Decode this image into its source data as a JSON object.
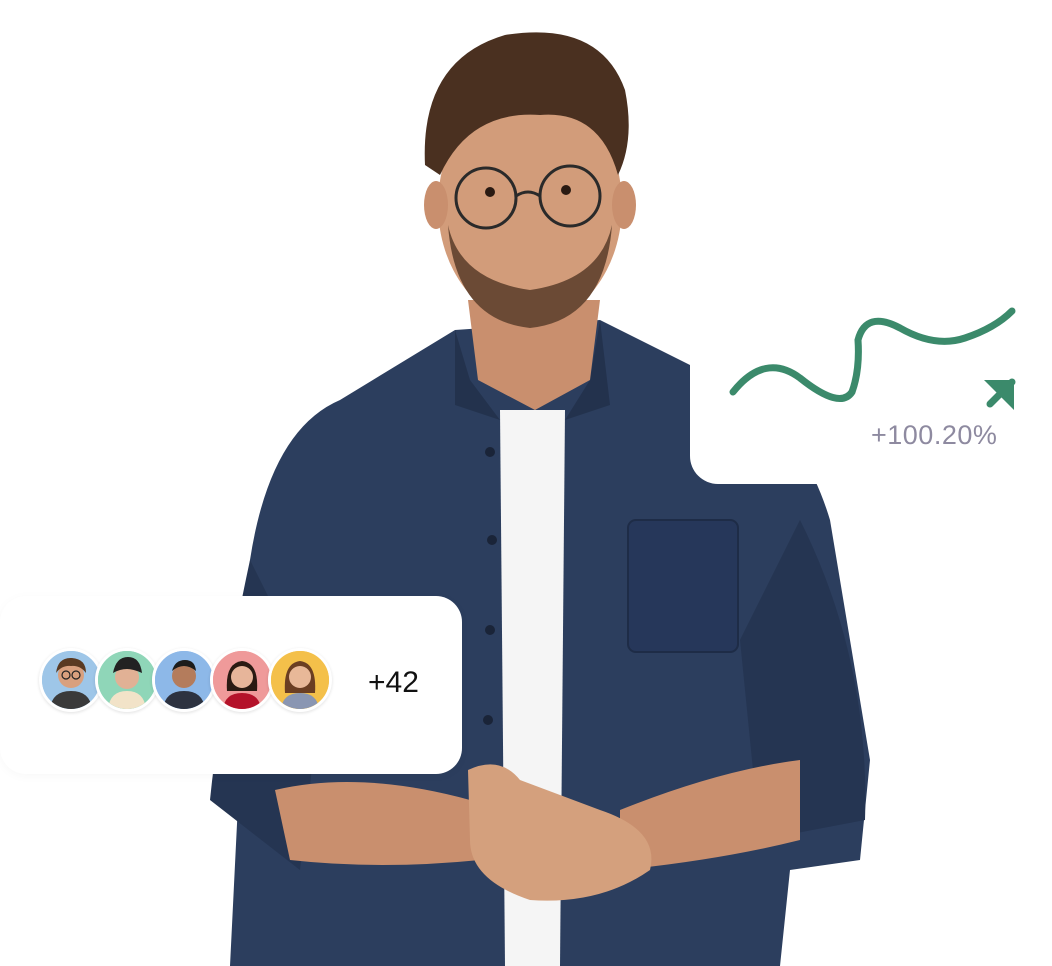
{
  "growth": {
    "value_label": "+100.20%",
    "line_color": "#3b8a6b",
    "label_color": "#8e8aa0"
  },
  "people": {
    "count_label": "+42",
    "avatars": [
      {
        "name": "avatar-1",
        "bg": "#9ec6e8",
        "shirt": "#3a3a3a",
        "hair": "#5a3a22"
      },
      {
        "name": "avatar-2",
        "bg": "#8fd6b8",
        "shirt": "#f2e3c8",
        "hair": "#222222"
      },
      {
        "name": "avatar-3",
        "bg": "#8db8e8",
        "shirt": "#2d3240",
        "hair": "#1c1c1c"
      },
      {
        "name": "avatar-4",
        "bg": "#ef9a9a",
        "shirt": "#b4122a",
        "hair": "#2a1a12"
      },
      {
        "name": "avatar-5",
        "bg": "#f4c04a",
        "shirt": "#8a96b2",
        "hair": "#6b3e22"
      }
    ]
  },
  "colors": {
    "shirt": "#2c3e5e",
    "skin": "#c98f6e",
    "tshirt": "#f5f5f5"
  }
}
